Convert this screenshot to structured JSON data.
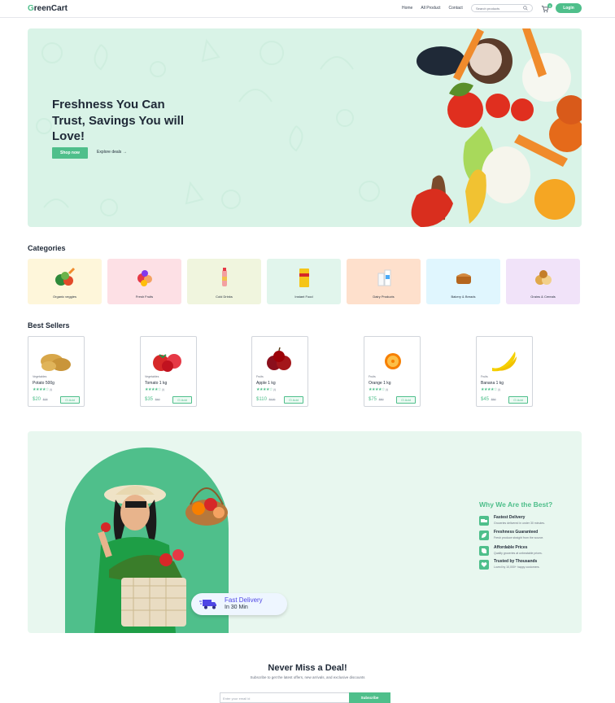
{
  "brand": {
    "logo_text": "reenCart",
    "logo_letter": "G"
  },
  "nav": {
    "links": [
      "Home",
      "All Product",
      "Contact"
    ],
    "search_placeholder": "Search products",
    "cart_count": "0",
    "login_label": "Login"
  },
  "hero": {
    "title": "Freshness You Can Trust, Savings You will Love!",
    "shop_label": "Shop now",
    "explore_label": "Explore deals"
  },
  "categories": {
    "title": "Categories",
    "items": [
      {
        "label": "Organic veggies",
        "bg": "#fef6da"
      },
      {
        "label": "Fresh Fruits",
        "bg": "#fde0e5"
      },
      {
        "label": "Cold Drinks",
        "bg": "#f0f5de"
      },
      {
        "label": "Instant Food",
        "bg": "#e1f5ec"
      },
      {
        "label": "Dairy Products",
        "bg": "#fee0cc"
      },
      {
        "label": "Bakery & Breads",
        "bg": "#e0f6fe"
      },
      {
        "label": "Grains & Cereals",
        "bg": "#f1e3f9"
      }
    ]
  },
  "best_sellers": {
    "title": "Best Sellers",
    "add_label": "Add",
    "products": [
      {
        "category": "Vegetables",
        "name": "Potato 500g",
        "rating_count": "(4)",
        "price": "$20",
        "old_price": "$25"
      },
      {
        "category": "Vegetables",
        "name": "Tomato 1 kg",
        "rating_count": "(4)",
        "price": "$35",
        "old_price": "$40"
      },
      {
        "category": "Fruits",
        "name": "Apple 1 kg",
        "rating_count": "(4)",
        "price": "$110",
        "old_price": "$120"
      },
      {
        "category": "Fruits",
        "name": "Orange 1 kg",
        "rating_count": "(4)",
        "price": "$75",
        "old_price": "$80"
      },
      {
        "category": "Fruits",
        "name": "Banana 1 kg",
        "rating_count": "(4)",
        "price": "$45",
        "old_price": "$50"
      }
    ]
  },
  "why": {
    "title": "Why We Are the Best?",
    "items": [
      {
        "title": "Fastest Delivery",
        "desc": "Groceries delivered in under 30 minutes."
      },
      {
        "title": "Freshness Guaranteed",
        "desc": "Fresh produce straight from the source."
      },
      {
        "title": "Affordable Prices",
        "desc": "Quality groceries at unbeatable prices."
      },
      {
        "title": "Trusted by Thousands",
        "desc": "Loved by 10,000+ happy customers."
      }
    ],
    "badge_line1": "Fast Delivery",
    "badge_line2": "In 30 Min"
  },
  "newsletter": {
    "title": "Never Miss a Deal!",
    "subtitle": "Subscribe to get the latest offers, new arrivals, and exclusive discounts",
    "placeholder": "Enter your email id",
    "button_label": "Subscribe"
  },
  "colors": {
    "accent": "#4fbf8b",
    "hero_bg": "#d9f3e7",
    "why_bg": "#e8f7ef"
  }
}
